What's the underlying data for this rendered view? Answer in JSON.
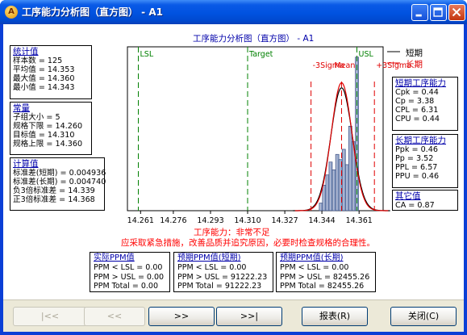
{
  "window": {
    "title": "工序能力分析图（直方图） - A1",
    "icon_name": "app-a-icon",
    "controls": [
      "minimize-icon",
      "maximize-icon",
      "close-icon"
    ]
  },
  "chart_title": "工序能力分析图（直方图） - A1",
  "stats": {
    "title": "统计值",
    "rows": [
      "样本数 = 125",
      "平均值 = 14.353",
      "最大值 = 14.360",
      "最小值 = 14.343"
    ]
  },
  "constants": {
    "title": "常量",
    "rows": [
      "子组大小 = 5",
      "规格下限 = 14.260",
      "目标值 = 14.310",
      "规格上限 = 14.360"
    ]
  },
  "calculated": {
    "title": "计算值",
    "rows": [
      "标准差(短期) = 0.004936",
      "标准差(长期) = 0.004740",
      "负3倍标准差 = 14.339",
      "正3倍标准差 = 14.368"
    ]
  },
  "legend": {
    "short_label": "短期",
    "long_label": "长期",
    "short_color": "#000000",
    "long_color": "#e00000"
  },
  "short_capability": {
    "title": "短期工序能力",
    "rows": [
      "Cpk  = 0.44",
      "Cp    = 3.38",
      "CPL  = 6.31",
      "CPU  = 0.44"
    ]
  },
  "long_capability": {
    "title": "长期工序能力",
    "rows": [
      "Ppk  = 0.46",
      "Pp    = 3.52",
      "PPL  = 6.57",
      "PPU  = 0.46"
    ]
  },
  "other": {
    "title": "其它值",
    "rows": [
      "CA  =  0.87"
    ]
  },
  "chart_data": {
    "type": "bar",
    "x_ticks": [
      "14.261",
      "14.276",
      "14.293",
      "14.310",
      "14.327",
      "14.344",
      "14.361"
    ],
    "xlim": [
      14.255,
      14.372
    ],
    "reference_lines": [
      {
        "label": "LSL",
        "value": 14.26,
        "color": "#008000",
        "style": "dash"
      },
      {
        "label": "Target",
        "value": 14.31,
        "color": "#008000",
        "style": "dash"
      },
      {
        "label": "USL",
        "value": 14.36,
        "color": "#008000",
        "style": "dash"
      },
      {
        "label": "-3Sigma",
        "value": 14.339,
        "color": "#e00000",
        "style": "dash"
      },
      {
        "label": "Mean",
        "value": 14.353,
        "color": "#e00000",
        "style": "dash"
      },
      {
        "label": "+3Sigma",
        "value": 14.368,
        "color": "#e00000",
        "style": "dash"
      }
    ],
    "ref_label_texts": {
      "lsl": "LSL",
      "target": "Target",
      "usl": "USL",
      "minus3": "-3Sigma",
      "mean": "Mean",
      "plus3": "+3Sigma"
    },
    "bins": [
      {
        "x": 14.3435,
        "value": 3
      },
      {
        "x": 14.345,
        "value": 10
      },
      {
        "x": 14.3465,
        "value": 14
      },
      {
        "x": 14.348,
        "value": 19
      },
      {
        "x": 14.3495,
        "value": 16
      },
      {
        "x": 14.351,
        "value": 22
      },
      {
        "x": 14.3525,
        "value": 20
      },
      {
        "x": 14.354,
        "value": 24
      },
      {
        "x": 14.3555,
        "value": 18
      },
      {
        "x": 14.357,
        "value": 33
      },
      {
        "x": 14.3585,
        "value": 27
      },
      {
        "x": 14.36,
        "value": 60
      }
    ],
    "ylim": [
      0,
      64
    ],
    "curves": [
      {
        "name": "短期",
        "mean": 14.353,
        "sd": 0.004936,
        "color": "#000000"
      },
      {
        "name": "长期",
        "mean": 14.353,
        "sd": 0.00474,
        "color": "#e00000"
      }
    ],
    "bar_color": "#8aa0c8",
    "bar_highlight": "#c8c8d8"
  },
  "message": {
    "line1": "工序能力：非常不足",
    "line2": "应采取紧急措施，改善品质并追究原因，必要时检查规格的合理性。"
  },
  "ppm_actual": {
    "title": "实际PPM值",
    "rows": [
      "PPM < LSL   =  0.00",
      "PPM > USL   =  0.00",
      "PPM Total    =  0.00"
    ]
  },
  "ppm_short": {
    "title": "预期PPM值(短期)",
    "rows": [
      "PPM < LSL   =  0.00",
      "PPM > USL   =  91222.23",
      "PPM Total    =  91222.23"
    ]
  },
  "ppm_long": {
    "title": "预期PPM值(长期)",
    "rows": [
      "PPM < LSL   =  0.00",
      "PPM > USL   =  82455.26",
      "PPM Total    =  82455.26"
    ]
  },
  "buttons": {
    "first": "|<<",
    "prev": "<<",
    "next": ">>",
    "last": ">>|",
    "report": "报表(R)",
    "close": "关闭(C)"
  }
}
